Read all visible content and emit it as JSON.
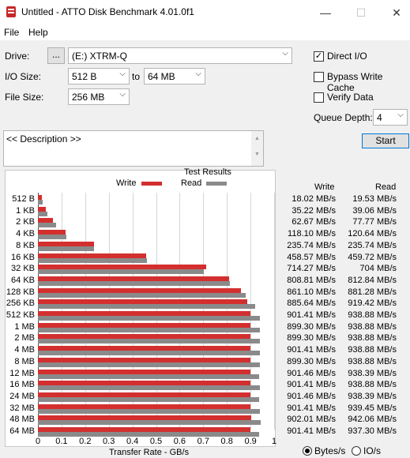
{
  "window": {
    "title": "Untitled - ATTO Disk Benchmark 4.01.0f1",
    "minimize": "—",
    "maximize": "☐",
    "close": "✕"
  },
  "menu": {
    "file": "File",
    "help": "Help"
  },
  "drive": {
    "label": "Drive:",
    "browse": "...",
    "value": "(E:) XTRM-Q"
  },
  "io_size": {
    "label": "I/O Size:",
    "from": "512 B",
    "to_label": "to",
    "to": "64 MB"
  },
  "file_size": {
    "label": "File Size:",
    "value": "256 MB"
  },
  "options": {
    "direct_io": "Direct I/O",
    "direct_io_checked": true,
    "bypass": "Bypass Write Cache",
    "bypass_checked": false,
    "verify": "Verify Data",
    "verify_checked": false
  },
  "queue": {
    "label": "Queue Depth:",
    "value": "4"
  },
  "start_label": "Start",
  "description": "<< Description >>",
  "results": {
    "title": "Test Results",
    "write_label": "Write",
    "read_label": "Read",
    "col_write": "Write",
    "col_read": "Read",
    "xlabel": "Transfer Rate - GB/s",
    "units": {
      "bytes": "Bytes/s",
      "io": "IO/s",
      "selected": "Bytes/s"
    }
  },
  "chart_data": {
    "type": "bar",
    "orientation": "horizontal",
    "title": "Test Results",
    "xlabel": "Transfer Rate - GB/s",
    "xlim": [
      0,
      1
    ],
    "xticks": [
      "0",
      "0.1",
      "0.2",
      "0.3",
      "0.4",
      "0.5",
      "0.6",
      "0.7",
      "0.8",
      "0.9",
      "1"
    ],
    "grid": true,
    "categories": [
      "512 B",
      "1 KB",
      "2 KB",
      "4 KB",
      "8 KB",
      "16 KB",
      "32 KB",
      "64 KB",
      "128 KB",
      "256 KB",
      "512 KB",
      "1 MB",
      "2 MB",
      "4 MB",
      "8 MB",
      "12 MB",
      "16 MB",
      "24 MB",
      "32 MB",
      "48 MB",
      "64 MB"
    ],
    "series": [
      {
        "name": "Write",
        "color": "#d32f2f",
        "values": [
          0.018,
          0.035,
          0.063,
          0.118,
          0.236,
          0.459,
          0.714,
          0.809,
          0.861,
          0.886,
          0.901,
          0.899,
          0.899,
          0.901,
          0.899,
          0.901,
          0.901,
          0.901,
          0.901,
          0.902,
          0.901
        ],
        "labels": [
          "18.02 MB/s",
          "35.22 MB/s",
          "62.67 MB/s",
          "118.10 MB/s",
          "235.74 MB/s",
          "458.57 MB/s",
          "714.27 MB/s",
          "808.81 MB/s",
          "861.10 MB/s",
          "885.64 MB/s",
          "901.41 MB/s",
          "899.30 MB/s",
          "899.30 MB/s",
          "901.41 MB/s",
          "899.30 MB/s",
          "901.46 MB/s",
          "901.41 MB/s",
          "901.46 MB/s",
          "901.41 MB/s",
          "902.01 MB/s",
          "901.41 MB/s"
        ]
      },
      {
        "name": "Read",
        "color": "#8a8a8a",
        "values": [
          0.02,
          0.039,
          0.078,
          0.121,
          0.236,
          0.46,
          0.704,
          0.813,
          0.881,
          0.919,
          0.939,
          0.939,
          0.939,
          0.939,
          0.939,
          0.938,
          0.939,
          0.938,
          0.939,
          0.942,
          0.937
        ],
        "labels": [
          "19.53 MB/s",
          "39.06 MB/s",
          "77.77 MB/s",
          "120.64 MB/s",
          "235.74 MB/s",
          "459.72 MB/s",
          "704 MB/s",
          "812.84 MB/s",
          "881.28 MB/s",
          "919.42 MB/s",
          "938.88 MB/s",
          "938.88 MB/s",
          "938.88 MB/s",
          "938.88 MB/s",
          "938.88 MB/s",
          "938.39 MB/s",
          "938.88 MB/s",
          "938.39 MB/s",
          "939.45 MB/s",
          "942.06 MB/s",
          "937.30 MB/s"
        ]
      }
    ]
  }
}
